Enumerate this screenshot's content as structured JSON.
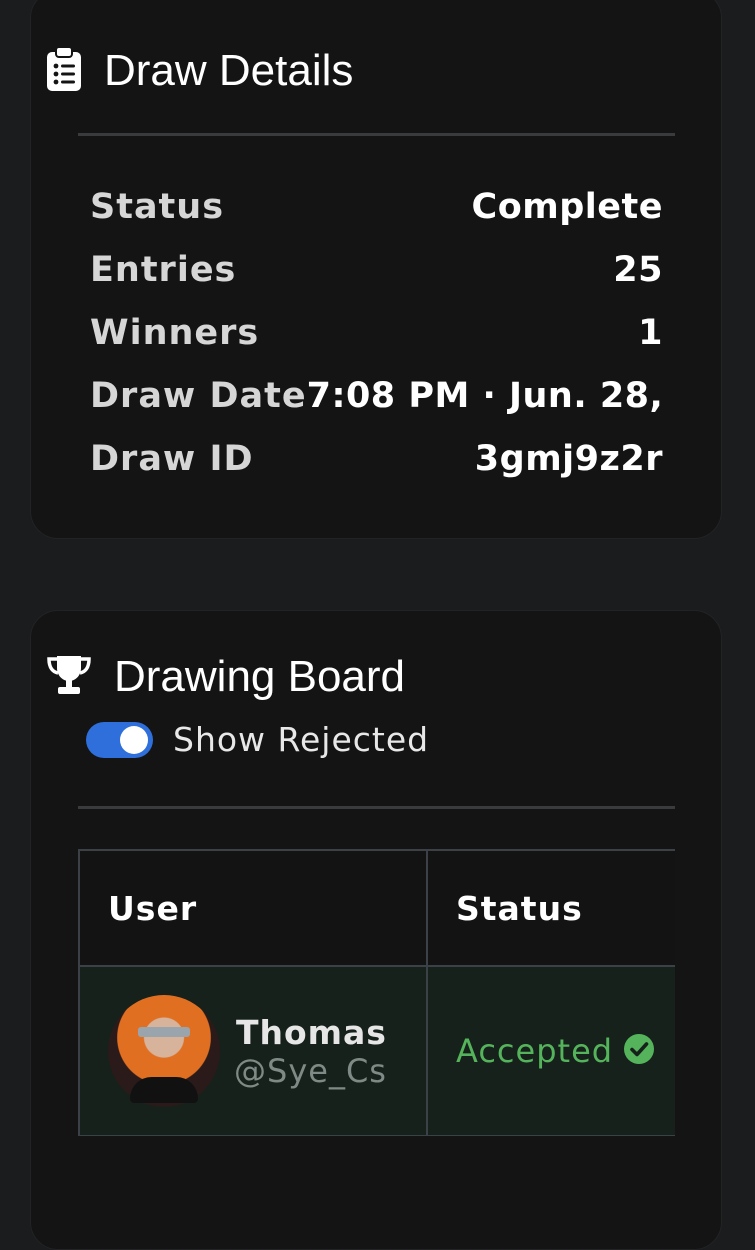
{
  "draw_details": {
    "title": "Draw Details",
    "icon": "clipboard-list-icon",
    "rows": [
      {
        "label": "Status",
        "value": "Complete"
      },
      {
        "label": "Entries",
        "value": "25"
      },
      {
        "label": "Winners",
        "value": "1"
      },
      {
        "label": "Draw Date",
        "value": "7:08 PM · Jun. 28,"
      },
      {
        "label": "Draw ID",
        "value": "3gmj9z2r"
      }
    ]
  },
  "drawing_board": {
    "title": "Drawing Board",
    "icon": "trophy-icon",
    "toggle": {
      "label": "Show Rejected",
      "on": true
    },
    "table": {
      "headers": [
        "User",
        "Status"
      ],
      "rows": [
        {
          "name": "Thomas",
          "handle": "@Sye_Cs",
          "status": "Accepted",
          "status_icon": "check-circle-icon"
        }
      ]
    }
  },
  "colors": {
    "accent": "#2f6fdc",
    "accepted": "#55b35b",
    "card_bg": "#141414",
    "page_bg": "#1b1c1e"
  }
}
